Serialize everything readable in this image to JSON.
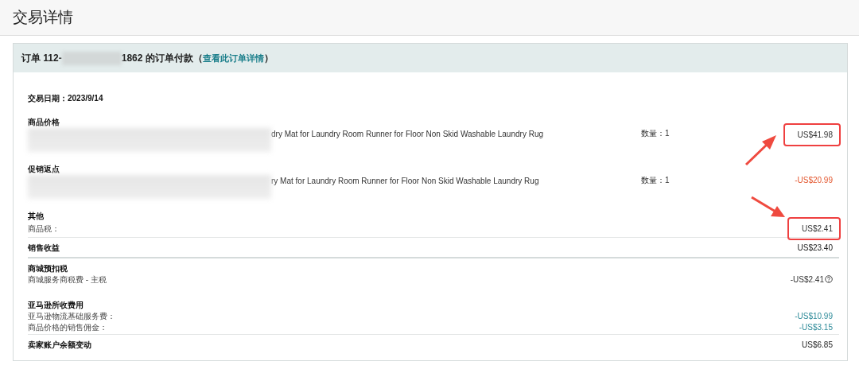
{
  "page_title": "交易详情",
  "order": {
    "prefix": "订单 112-",
    "suffix": "1862 的订单付款",
    "paren_open": "（",
    "link": "查看此订单详情",
    "paren_close": "）"
  },
  "sections": [
    {
      "kind": "date",
      "title": "交易日期：2023/9/14",
      "divider_after": false
    },
    {
      "kind": "product",
      "title": "商品价格",
      "item": "dry Mat for Laundry Room Runner for Floor Non Skid Washable Laundry Rug",
      "quantity": "数量：1",
      "amount": "US$41.98",
      "color": "#333333",
      "highlighted": true,
      "divider_after": false
    },
    {
      "kind": "product",
      "title": "促销返点",
      "item": "ry Mat for Laundry Room Runner for Floor Non Skid Washable Laundry Rug",
      "quantity": "数量：1",
      "amount": "-US$20.99",
      "color": "#e3572f",
      "highlighted": false,
      "divider_after": false
    },
    {
      "kind": "group",
      "title": "其他",
      "divider_after": true,
      "lines": [
        {
          "label": "商品税：",
          "amount": "US$2.41",
          "color": "#333333",
          "highlighted": true,
          "help": false
        }
      ]
    },
    {
      "kind": "total",
      "title": "销售收益",
      "amount": "US$23.40",
      "divider_after": true
    },
    {
      "kind": "group",
      "title": "商城预扣税",
      "divider_after": false,
      "lines": [
        {
          "label": "商城服务商税费 - 主税",
          "amount": "-US$2.41",
          "color": "#333333",
          "highlighted": false,
          "help": true
        }
      ]
    },
    {
      "kind": "group",
      "title": "亚马逊所收费用",
      "divider_after": true,
      "lines": [
        {
          "label": "亚马逊物流基础服务费：",
          "amount": "-US$10.99",
          "color": "#2e8b99",
          "highlighted": false,
          "help": false
        },
        {
          "label": "商品价格的销售佣金：",
          "amount": "-US$3.15",
          "color": "#2e8b99",
          "highlighted": false,
          "help": false
        }
      ]
    },
    {
      "kind": "total",
      "title": "卖家账户余额变动",
      "amount": "US$6.85",
      "divider_after": false
    }
  ]
}
